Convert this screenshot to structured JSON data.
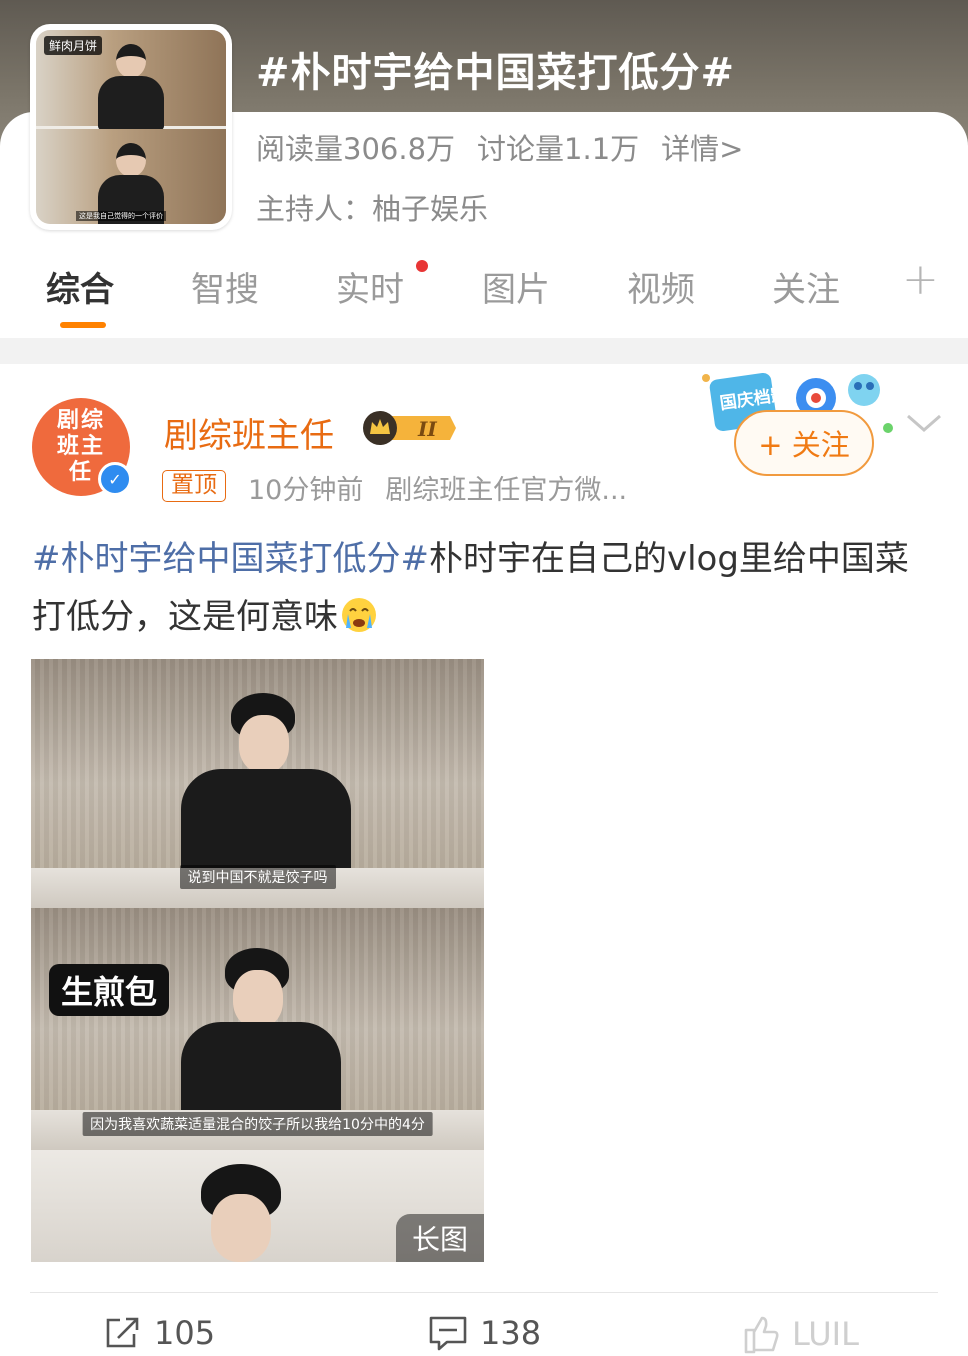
{
  "topic": {
    "title": "#朴时宇给中国菜打低分#",
    "cover_tag": "鲜肉月饼",
    "cover_sub": "这是我自己觉得的一个评价",
    "stats": {
      "reads": "阅读量306.8万",
      "discussions": "讨论量1.1万",
      "details": "详情>"
    },
    "host": "主持人：柚子娱乐"
  },
  "tabs": [
    {
      "label": "综合",
      "active": true
    },
    {
      "label": "智搜",
      "active": false
    },
    {
      "label": "实时",
      "active": false,
      "has_dot": true
    },
    {
      "label": "图片",
      "active": false
    },
    {
      "label": "视频",
      "active": false
    },
    {
      "label": "关注",
      "active": false
    }
  ],
  "tab_more": "+",
  "post": {
    "avatar_text": "剧综班主任",
    "author": "剧综班主任",
    "vip_level": "II",
    "pin_tag": "置顶",
    "time": "10分钟前",
    "source": "剧综班主任官方微...",
    "follow_label": "+ 关注",
    "follow_deco_text": "国庆档影评",
    "text_hashtag": "#朴时宇给中国菜打低分#",
    "text_body": "朴时宇在自己的vlog里给中国菜打低分，这是何意味",
    "image": {
      "subtitle_1": "说到中国不就是饺子吗",
      "food_label": "生煎包",
      "subtitle_2": "因为我喜欢蔬菜适量混合的饺子所以我给10分中的4分",
      "long_label": "长图"
    },
    "actions": {
      "repost": "105",
      "comments": "138",
      "likes": "LUIL"
    }
  },
  "colors": {
    "accent_orange": "#ff8200",
    "author_orange": "#e86b12",
    "hashtag_blue": "#4e6ea7",
    "verified_blue": "#2f8cf0",
    "dot_red": "#e83535"
  }
}
